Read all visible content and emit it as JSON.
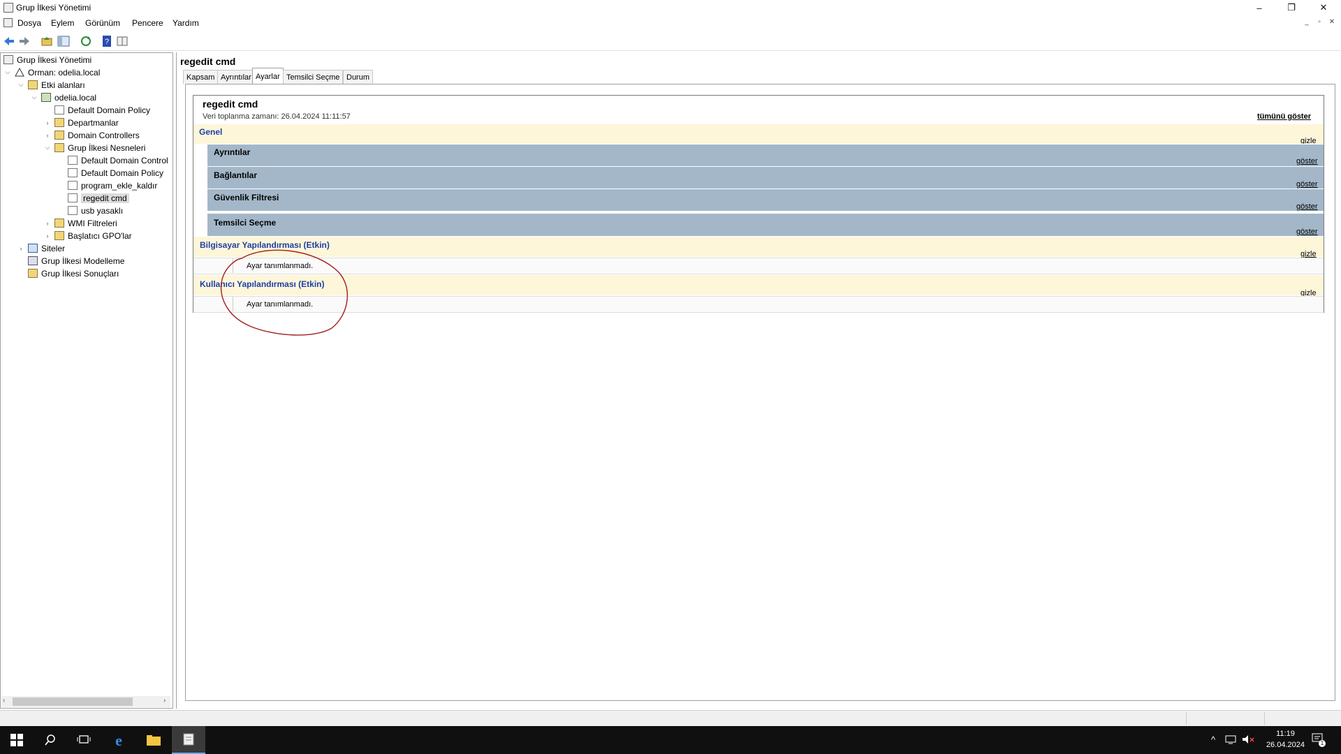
{
  "window": {
    "title": "Grup İlkesi Yönetimi",
    "controls": {
      "minimize": "–",
      "restore": "❐",
      "close": "✕"
    }
  },
  "menu": [
    "Dosya",
    "Eylem",
    "Görünüm",
    "Pencere",
    "Yardım"
  ],
  "mdi_controls": [
    "_",
    "▫",
    "✕"
  ],
  "tree": {
    "root": "Grup İlkesi Yönetimi",
    "forest": "Orman: odelia.local",
    "domains": "Etki alanları",
    "domain": "odelia.local",
    "items": {
      "default_domain_policy": "Default Domain Policy",
      "departmanlar": "Departmanlar",
      "domain_controllers": "Domain Controllers",
      "gpo_container": "Grup İlkesi Nesneleri",
      "gpo_ddc": "Default Domain Control",
      "gpo_ddp": "Default Domain Policy",
      "gpo_program": "program_ekle_kaldır",
      "gpo_regedit": "regedit cmd",
      "gpo_usb": "usb yasaklı",
      "wmi": "WMI Filtreleri",
      "starter": "Başlatıcı GPO'lar",
      "sites": "Siteler",
      "modeling": "Grup İlkesi Modelleme",
      "results": "Grup İlkesi Sonuçları"
    }
  },
  "content": {
    "title": "regedit cmd",
    "tabs": [
      "Kapsam",
      "Ayrıntılar",
      "Ayarlar",
      "Temsilci Seçme",
      "Durum"
    ],
    "active_tab": "Ayarlar",
    "report": {
      "title": "regedit cmd",
      "collected": "Veri toplanma zamanı: 26.04.2024 11:11:57",
      "show_all": "tümünü göster",
      "general": {
        "label": "Genel",
        "toggle": "gizle"
      },
      "subsections": [
        {
          "label": "Ayrıntılar",
          "toggle": "göster"
        },
        {
          "label": "Bağlantılar",
          "toggle": "göster"
        },
        {
          "label": "Güvenlik Filtresi",
          "toggle": "göster"
        },
        {
          "label": "Temsilci Seçme",
          "toggle": "göster"
        }
      ],
      "computer": {
        "label": "Bilgisayar Yapılandırması (Etkin)",
        "toggle": "gizle",
        "note": "Ayar tanımlanmadı."
      },
      "user": {
        "label": "Kullanıcı Yapılandırması (Etkin)",
        "toggle": "gizle",
        "note": "Ayar tanımlanmadı."
      }
    }
  },
  "taskbar": {
    "time": "11:19",
    "date": "26.04.2024",
    "notification_count": "1"
  },
  "colors": {
    "section_yellow": "#fef6d9",
    "subsection_blue": "#a3b7c9",
    "section_text": "#1c3fa8",
    "annotation_red": "#a02020"
  }
}
